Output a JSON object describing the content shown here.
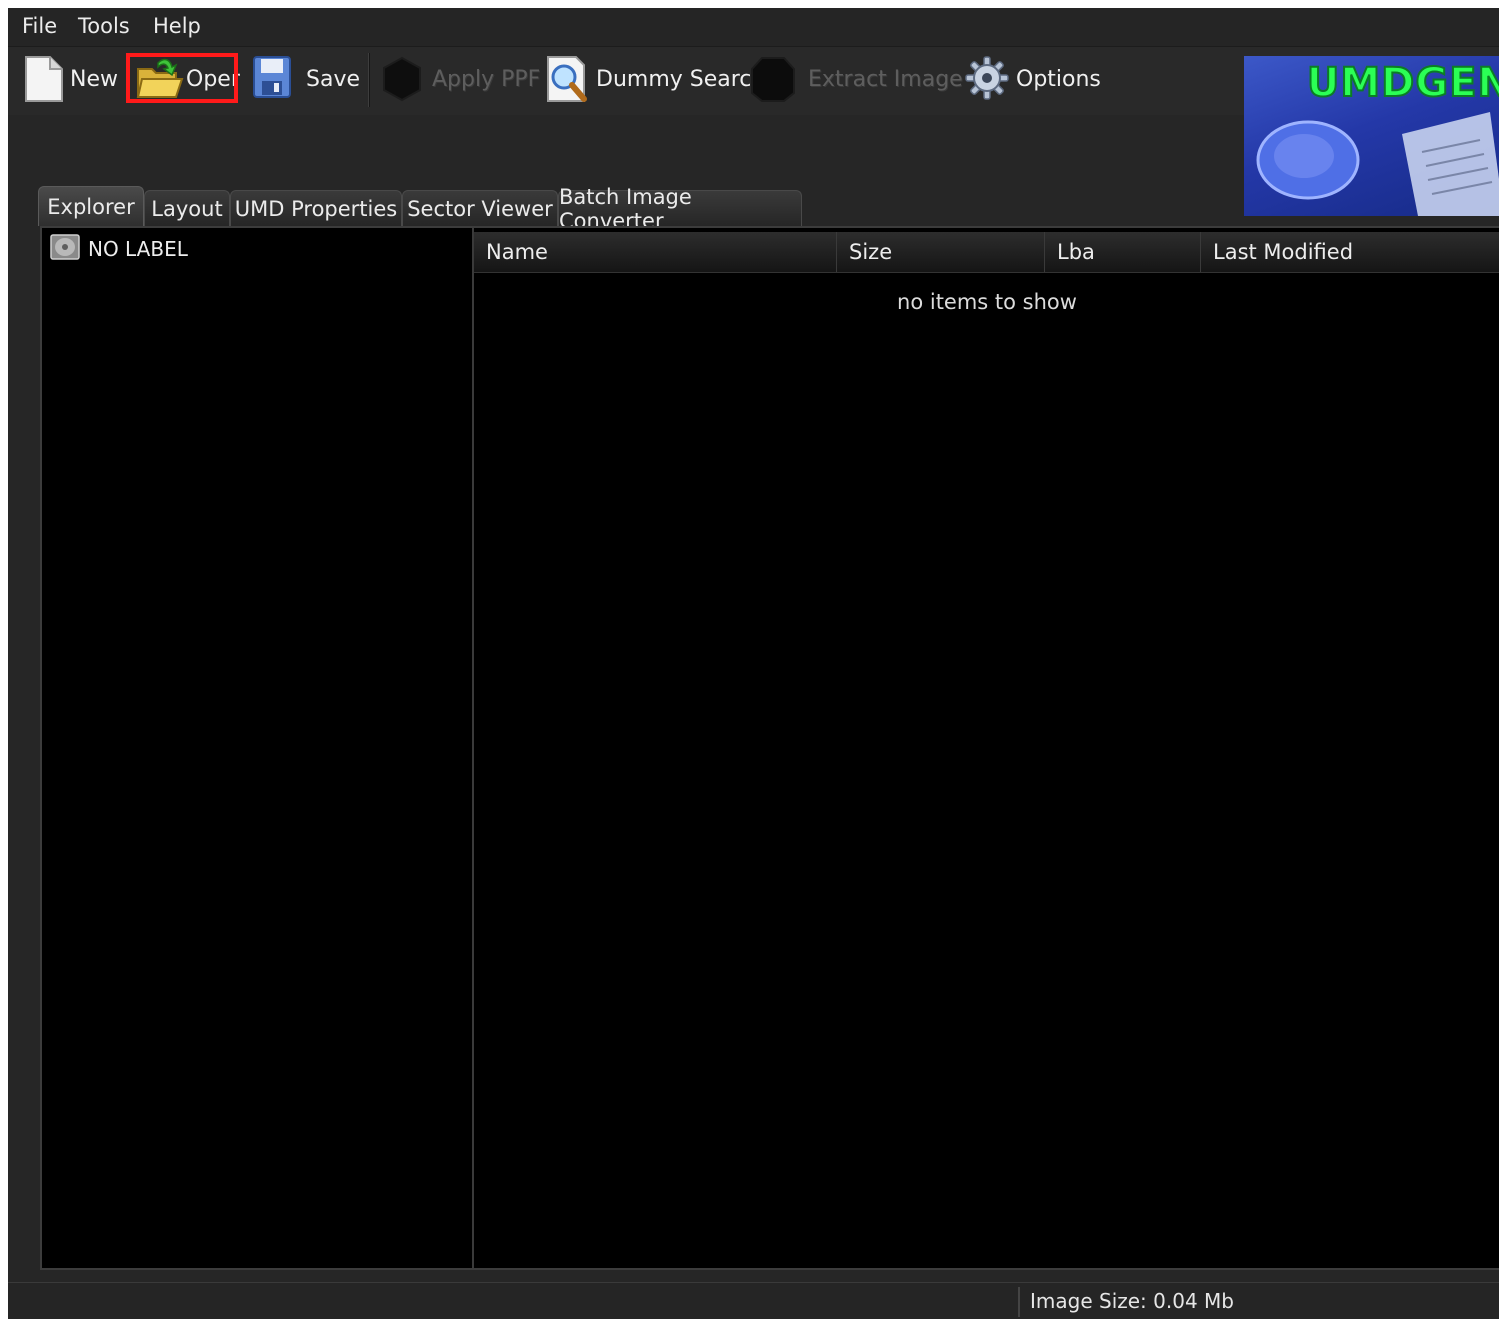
{
  "menu": {
    "file": "File",
    "tools": "Tools",
    "help": "Help"
  },
  "toolbar": {
    "new_label": "New",
    "open_label": "Oper",
    "save_label": "Save",
    "apply_ppf_label": "Apply PPF",
    "dummy_search_label": "Dummy Search",
    "extract_image_label": "Extract Image",
    "options_label": "Options"
  },
  "banner": {
    "logo_text": "UMDGEN"
  },
  "tabs": [
    "Explorer",
    "Layout",
    "UMD Properties",
    "Sector Viewer",
    "Batch Image Converter"
  ],
  "tree": {
    "root_label": "NO LABEL"
  },
  "list": {
    "columns": [
      "Name",
      "Size",
      "Lba",
      "Last Modified"
    ],
    "empty_message": "no items to show"
  },
  "status": {
    "image_size": "Image Size: 0.04 Mb"
  }
}
